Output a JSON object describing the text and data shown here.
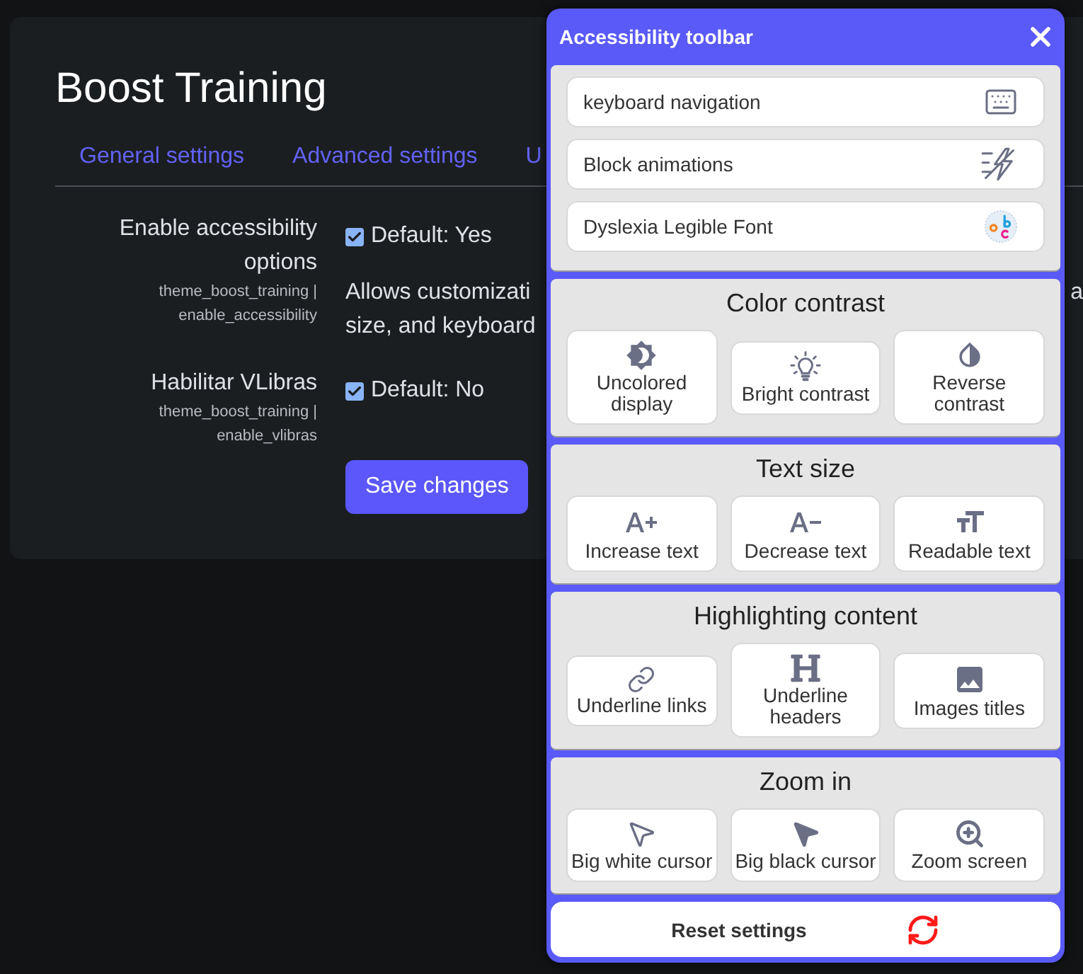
{
  "settings_page": {
    "title": "Boost Training",
    "tabs": [
      {
        "label": "General settings"
      },
      {
        "label": "Advanced settings"
      },
      {
        "label": "U"
      }
    ],
    "settings": [
      {
        "label": "Enable accessibility options",
        "key": "theme_boost_training | enable_accessibility",
        "checked": true,
        "default": "Default: Yes",
        "description_lines": [
          "Allows customizati",
          "size, and keyboard"
        ],
        "description_tail": "a"
      },
      {
        "label": "Habilitar VLibras",
        "key": "theme_boost_training | enable_vlibras",
        "checked": true,
        "default": "Default: No"
      }
    ],
    "save_button": "Save changes"
  },
  "toolbar": {
    "title": "Accessibility toolbar",
    "features": [
      {
        "label": "keyboard navigation",
        "kind": "keyboard"
      },
      {
        "label": "Block animations",
        "kind": "animations"
      },
      {
        "label": "Dyslexia Legible Font",
        "kind": "dyslexia"
      }
    ],
    "sections": [
      {
        "title": "Color contrast",
        "options": [
          {
            "label": "Uncolored display",
            "kind": "grayscale"
          },
          {
            "label": "Bright contrast",
            "kind": "bright"
          },
          {
            "label": "Reverse contrast",
            "kind": "invert"
          }
        ]
      },
      {
        "title": "Text size",
        "options": [
          {
            "label": "Increase text",
            "kind": "increase"
          },
          {
            "label": "Decrease text",
            "kind": "decrease"
          },
          {
            "label": "Readable text",
            "kind": "readable"
          }
        ]
      },
      {
        "title": "Highlighting content",
        "options": [
          {
            "label": "Underline links",
            "kind": "links"
          },
          {
            "label": "Underline headers",
            "kind": "headers"
          },
          {
            "label": "Images titles",
            "kind": "images"
          }
        ]
      },
      {
        "title": "Zoom in",
        "options": [
          {
            "label": "Big white cursor",
            "kind": "whitecursor"
          },
          {
            "label": "Big black cursor",
            "kind": "blackcursor"
          },
          {
            "label": "Zoom screen",
            "kind": "zoom"
          }
        ]
      }
    ],
    "reset": "Reset settings"
  }
}
